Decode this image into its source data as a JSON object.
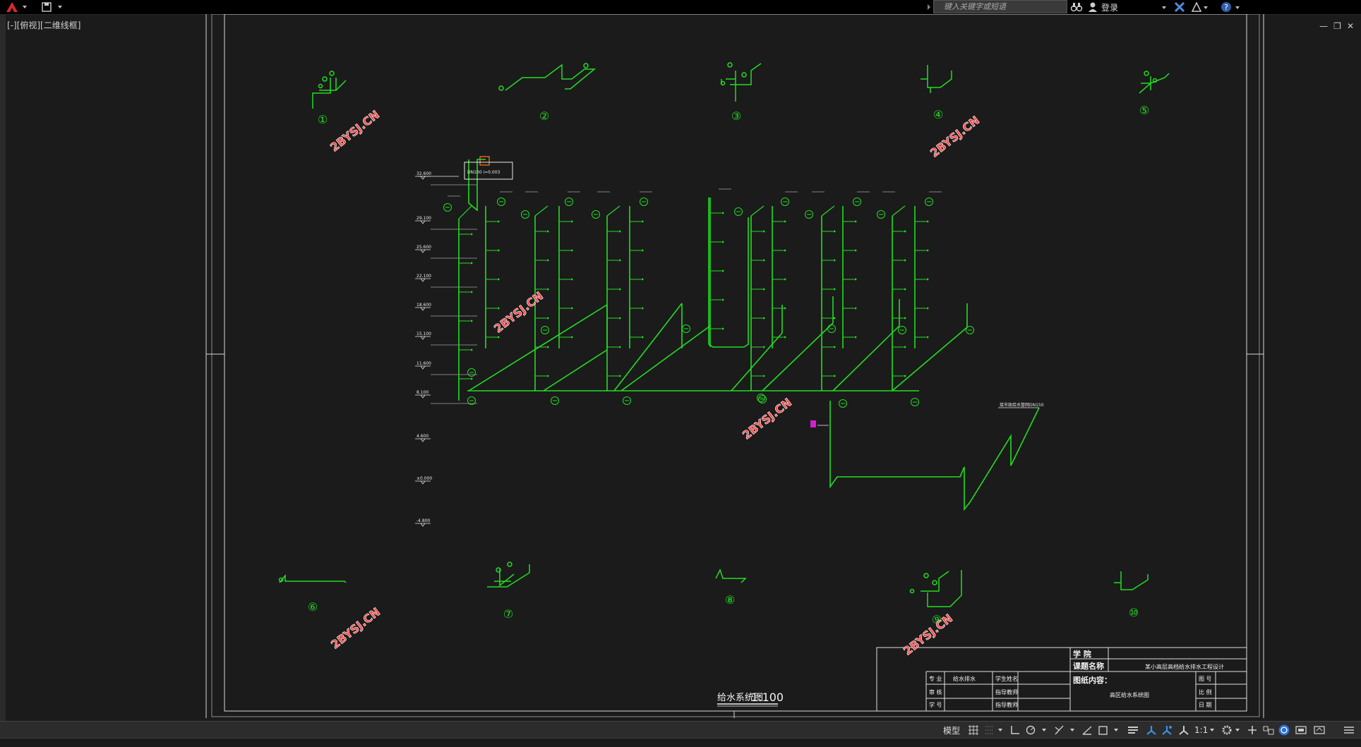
{
  "topbar": {
    "search_placeholder": "键入关键字或短语",
    "login_label": "登录"
  },
  "viewport": {
    "label": "[-][俯视][二维线框]"
  },
  "drawing": {
    "title": "给水系统图",
    "scale": "1:100",
    "watermark": "2BYSJ.CN",
    "detail_labels": [
      "①",
      "②",
      "③",
      "④",
      "⑤",
      "⑥",
      "⑦",
      "⑧",
      "⑨",
      "⑩"
    ],
    "elevations": [
      "32.600",
      "29.100",
      "25.600",
      "22.100",
      "18.600",
      "15.100",
      "11.600",
      "8.100",
      "4.600",
      "±0.000",
      "-4.800"
    ],
    "roof_note": "DN100 i=0.003",
    "inlet_note": "接市政给水管网DN150"
  },
  "titleblock": {
    "college": "学 院",
    "topic_label": "课题名称",
    "topic": "某小高层高档给水排水工程设计",
    "content_label": "图纸内容：",
    "content": "高区给水系统图",
    "row_major_label": "专 业",
    "row_major_value": "给水排水",
    "row_student_label": "学生姓名",
    "row_review_label": "审 核",
    "row_teacher_label": "指导教师",
    "row_id_label": "学 号",
    "row_teacher2_label": "指导教师",
    "drawing_no_label": "图 号",
    "scale_label": "比 例",
    "date_label": "日 期"
  },
  "statusbar": {
    "model_label": "模型",
    "scale_value": "1:1"
  },
  "colors": {
    "pipe": "#22dd22",
    "watermark": "#ff4a4a",
    "frame": "#e8e8e8",
    "background": "#1b1b1b"
  }
}
